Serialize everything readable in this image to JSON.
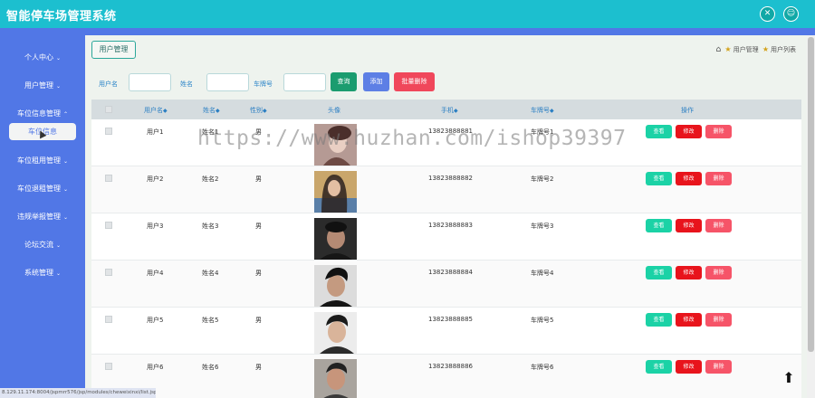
{
  "app": {
    "title": "智能停车场管理系统"
  },
  "sidebar": {
    "items": [
      {
        "label": "个人中心"
      },
      {
        "label": "用户管理"
      },
      {
        "label": "车位信息管理"
      },
      {
        "label": "车位信息"
      },
      {
        "label": "车位租用管理"
      },
      {
        "label": "车位退租管理"
      },
      {
        "label": "违规举报管理"
      },
      {
        "label": "论坛交流"
      },
      {
        "label": "系统管理"
      }
    ]
  },
  "tab": {
    "label": "用户管理"
  },
  "breadcrumb": {
    "items": [
      "用户管理",
      "用户列表"
    ]
  },
  "search": {
    "username_label": "用户名",
    "name_label": "姓名",
    "plate_label": "车牌号",
    "query_label": "查询",
    "add_label": "添加",
    "batch_delete_label": "批量删除"
  },
  "table": {
    "headers": [
      "用户名",
      "姓名",
      "性别",
      "头像",
      "手机",
      "车牌号",
      "操作"
    ],
    "sort_icon": "◆",
    "rows": [
      {
        "username": "用户1",
        "name": "姓名1",
        "gender": "男",
        "phone": "13823888881",
        "plate": "车牌号1"
      },
      {
        "username": "用户2",
        "name": "姓名2",
        "gender": "男",
        "phone": "13823888882",
        "plate": "车牌号2"
      },
      {
        "username": "用户3",
        "name": "姓名3",
        "gender": "男",
        "phone": "13823888883",
        "plate": "车牌号3"
      },
      {
        "username": "用户4",
        "name": "姓名4",
        "gender": "男",
        "phone": "13823888884",
        "plate": "车牌号4"
      },
      {
        "username": "用户5",
        "name": "姓名5",
        "gender": "男",
        "phone": "13823888885",
        "plate": "车牌号5"
      },
      {
        "username": "用户6",
        "name": "姓名6",
        "gender": "男",
        "phone": "13823888886",
        "plate": "车牌号6"
      }
    ],
    "actions": {
      "view": "查看",
      "edit": "修改",
      "delete": "删除"
    }
  },
  "status_url": "8.129.11.174:8004/jspmrr576/jsp/modules/cheweixinxi/list.jsp",
  "watermark": "https://www.huzhan.com/ishop39397",
  "colors": {
    "topbar": "#1cbfcf",
    "sidebar": "#5177e6",
    "query": "#1b9c6f",
    "add": "#5d7fe5",
    "danger": "#f0475b",
    "view": "#1bd2a6",
    "edit": "#e8141c",
    "delete": "#f65468"
  }
}
